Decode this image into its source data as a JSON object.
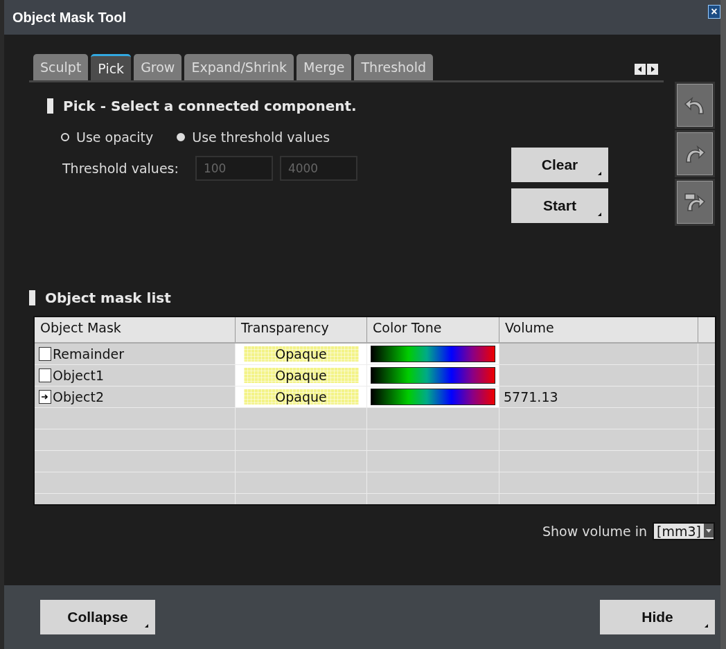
{
  "window": {
    "title": "Object Mask Tool",
    "close": "×"
  },
  "tabs": [
    {
      "label": "Sculpt",
      "selected": false
    },
    {
      "label": "Pick",
      "selected": true
    },
    {
      "label": "Grow",
      "selected": false
    },
    {
      "label": "Expand/Shrink",
      "selected": false
    },
    {
      "label": "Merge",
      "selected": false
    },
    {
      "label": "Threshold",
      "selected": false
    }
  ],
  "pick": {
    "heading": "Pick - Select a connected component.",
    "options": [
      {
        "label": "Use opacity",
        "selected": false
      },
      {
        "label": "Use threshold values",
        "selected": true
      }
    ],
    "threshold_label": "Threshold values:",
    "threshold_min": "100",
    "threshold_max": "4000",
    "threshold_disabled": true,
    "buttons": [
      "Clear",
      "Start"
    ]
  },
  "side_tools": [
    {
      "kind": "undo"
    },
    {
      "kind": "redo"
    },
    {
      "kind": "apply"
    }
  ],
  "mask_list": {
    "heading": "Object mask list",
    "columns": [
      "Object Mask",
      "Transparency",
      "Color Tone",
      "Volume"
    ],
    "rows": [
      {
        "name": "Remainder",
        "current": false,
        "transparency": "Opaque",
        "volume": ""
      },
      {
        "name": "Object1",
        "current": false,
        "transparency": "Opaque",
        "volume": ""
      },
      {
        "name": "Object2",
        "current": true,
        "transparency": "Opaque",
        "volume": "5771.13"
      }
    ]
  },
  "volume_unit": {
    "label": "Show volume in",
    "value": "[mm3]"
  },
  "footer_buttons": [
    "Collapse",
    "Hide"
  ]
}
